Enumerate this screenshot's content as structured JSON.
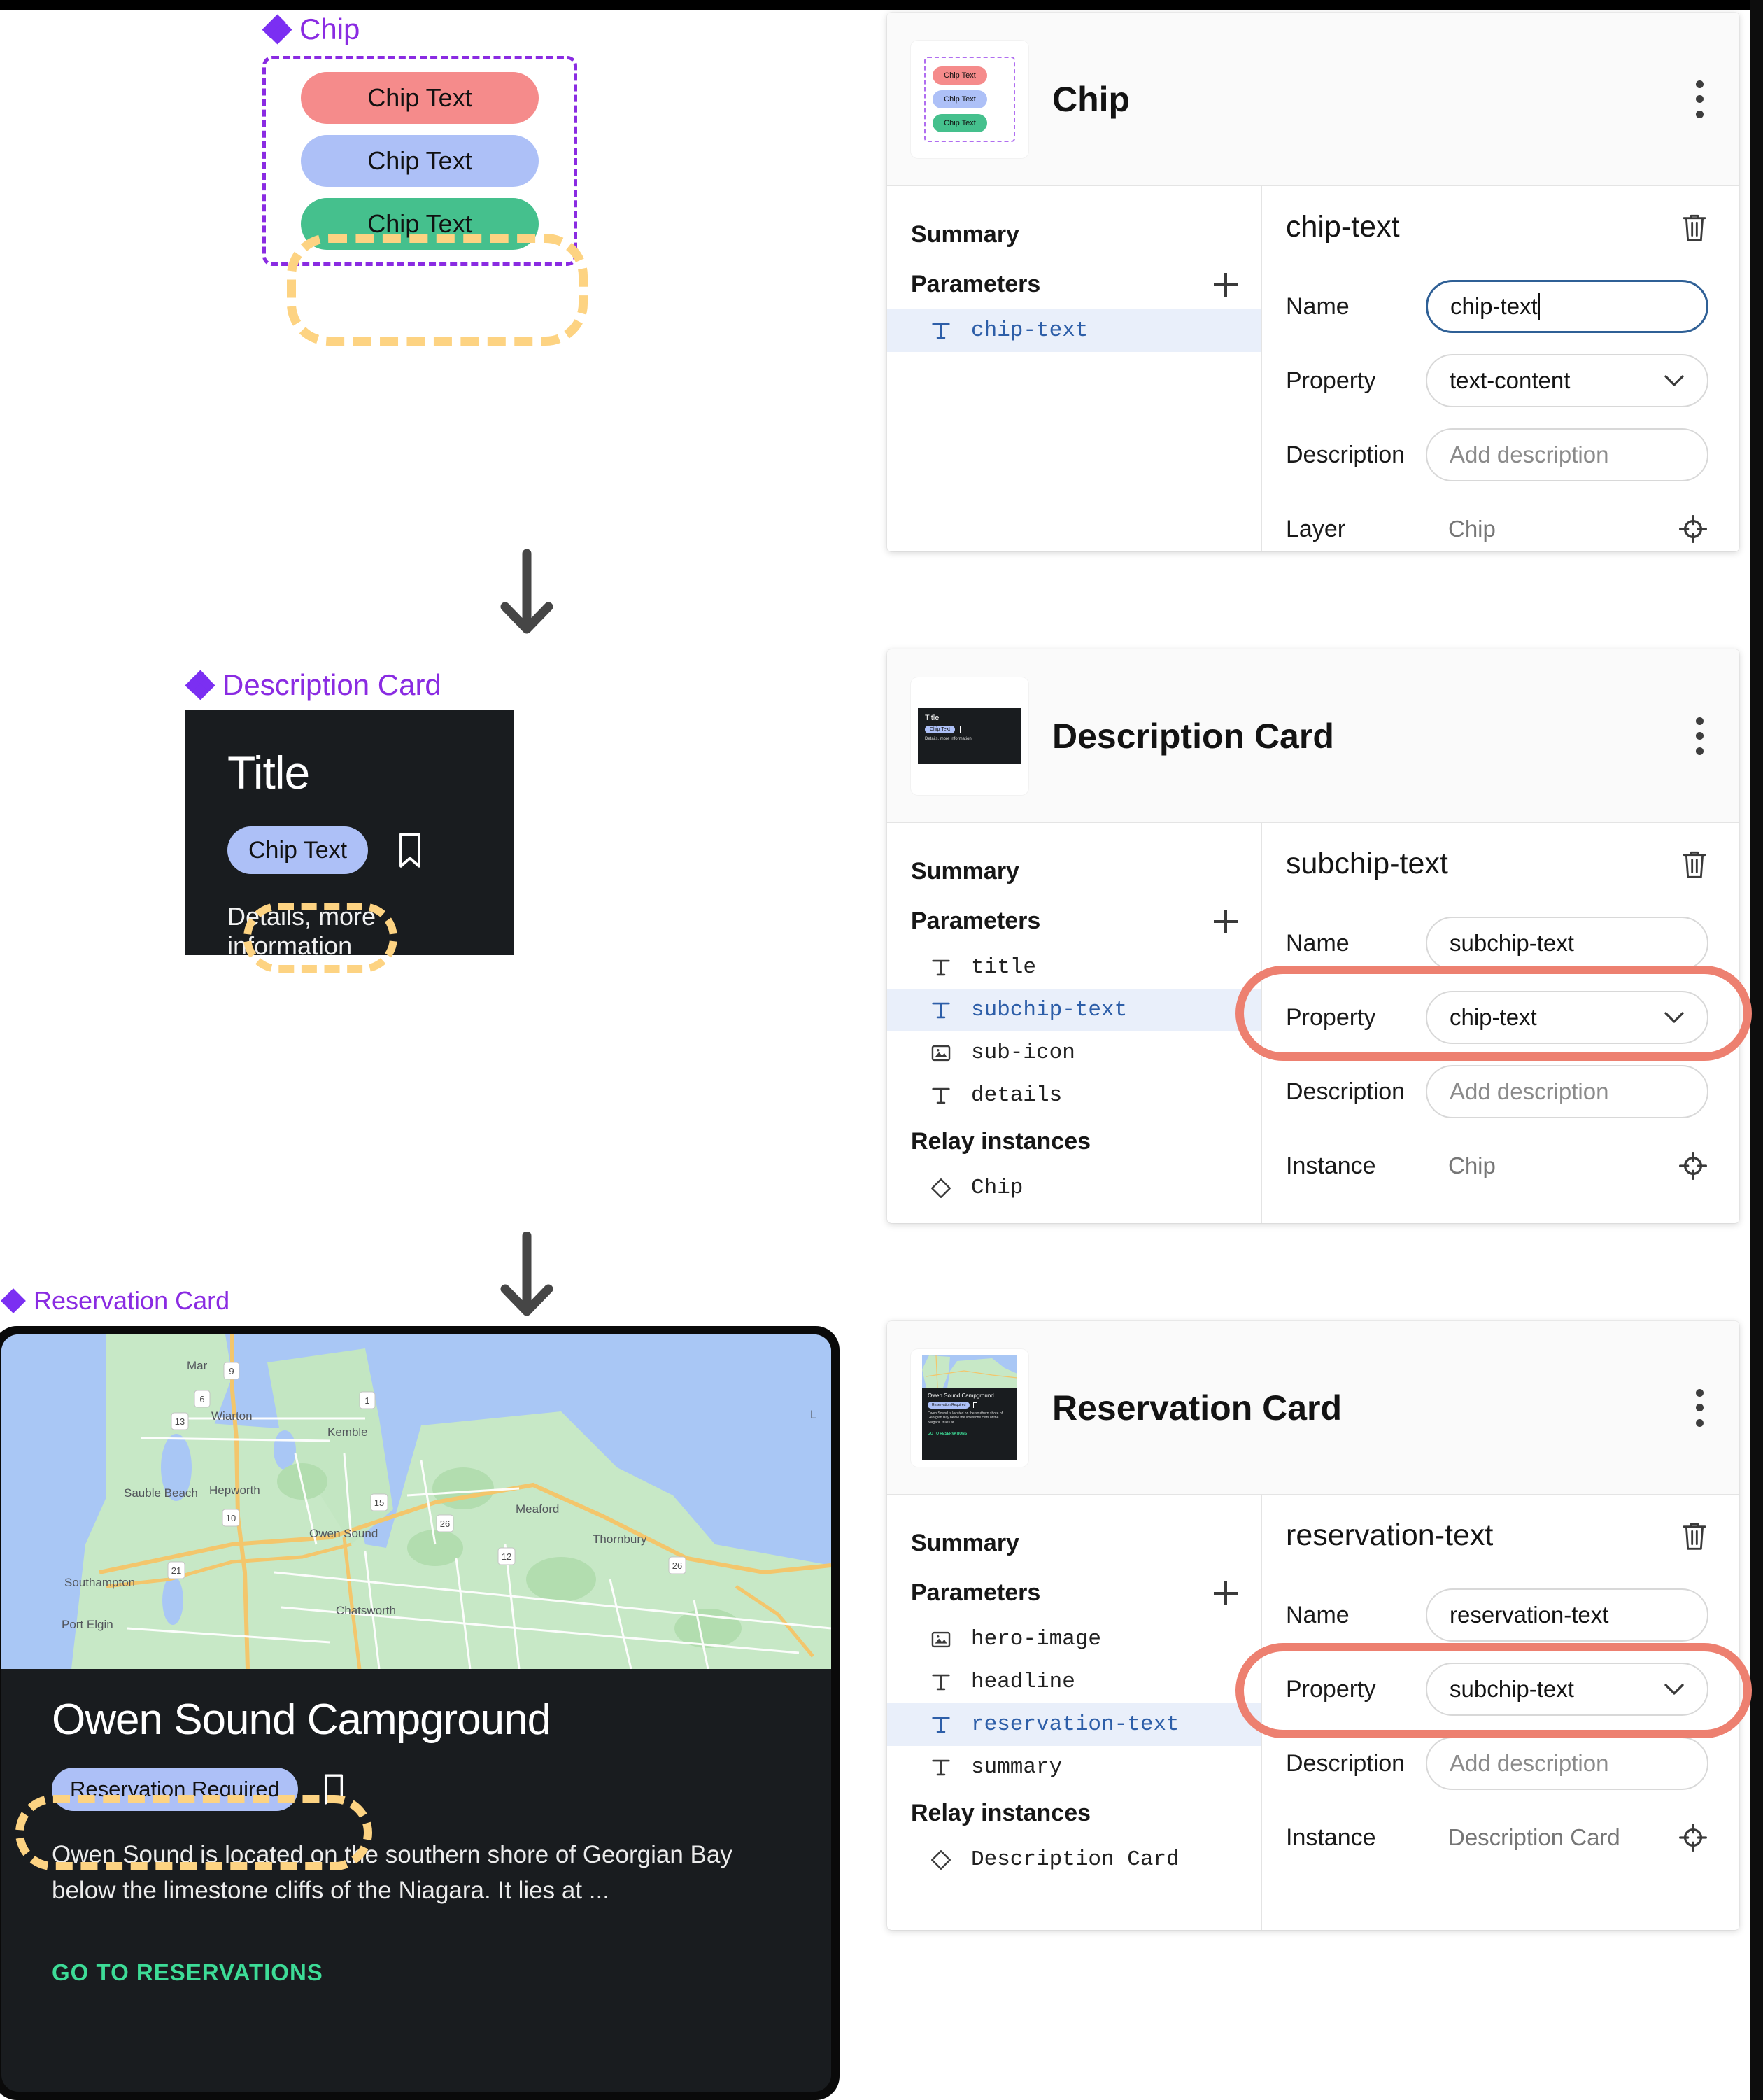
{
  "components": {
    "chip": {
      "label": "Chip",
      "chips": [
        {
          "text": "Chip Text",
          "color": "#f58b8b"
        },
        {
          "text": "Chip Text",
          "color": "#adc0f7"
        },
        {
          "text": "Chip Text",
          "color": "#45c08d"
        }
      ]
    },
    "description_card": {
      "label": "Description Card",
      "title": "Title",
      "chip_text": "Chip Text",
      "details": "Details, more information"
    },
    "reservation_card": {
      "label": "Reservation Card",
      "headline": "Owen Sound Campground",
      "chip_text": "Reservation Required",
      "summary": "Owen Sound is located on the southern shore of Georgian Bay below the limestone cliffs of the Niagara. It lies at ...",
      "action": "GO TO RESERVATIONS",
      "map_labels": [
        "Mar",
        "Wiarton",
        "Kemble",
        "Sauble Beach",
        "Hepworth",
        "Owen Sound",
        "Meaford",
        "Thornbury",
        "Southampton",
        "Chatsworth",
        "Port Elgin"
      ],
      "map_route_shields": [
        "9",
        "6",
        "1",
        "13",
        "15",
        "10",
        "26",
        "12",
        "26",
        "21"
      ]
    }
  },
  "panels": [
    {
      "title": "Chip",
      "summary_label": "Summary",
      "parameters_label": "Parameters",
      "parameters": [
        {
          "icon": "text-param-icon",
          "name": "chip-text",
          "selected": true
        }
      ],
      "relay_instances_label": null,
      "relay_instances": [],
      "detail": {
        "title": "chip-text",
        "name_label": "Name",
        "name_value": "chip-text",
        "name_focused": true,
        "property_label": "Property",
        "property_value": "text-content",
        "property_highlighted": false,
        "description_label": "Description",
        "description_placeholder": "Add description",
        "origin_label": "Layer",
        "origin_value": "Chip"
      }
    },
    {
      "title": "Description Card",
      "summary_label": "Summary",
      "parameters_label": "Parameters",
      "parameters": [
        {
          "icon": "text-param-icon",
          "name": "title",
          "selected": false
        },
        {
          "icon": "text-param-icon",
          "name": "subchip-text",
          "selected": true
        },
        {
          "icon": "image-param-icon",
          "name": "sub-icon",
          "selected": false
        },
        {
          "icon": "text-param-icon",
          "name": "details",
          "selected": false
        }
      ],
      "relay_instances_label": "Relay instances",
      "relay_instances": [
        {
          "icon": "diamond-instance-icon",
          "name": "Chip"
        }
      ],
      "detail": {
        "title": "subchip-text",
        "name_label": "Name",
        "name_value": "subchip-text",
        "name_focused": false,
        "property_label": "Property",
        "property_value": "chip-text",
        "property_highlighted": true,
        "description_label": "Description",
        "description_placeholder": "Add description",
        "origin_label": "Instance",
        "origin_value": "Chip"
      }
    },
    {
      "title": "Reservation Card",
      "summary_label": "Summary",
      "parameters_label": "Parameters",
      "parameters": [
        {
          "icon": "image-param-icon",
          "name": "hero-image",
          "selected": false
        },
        {
          "icon": "text-param-icon",
          "name": "headline",
          "selected": false
        },
        {
          "icon": "text-param-icon",
          "name": "reservation-text",
          "selected": true
        },
        {
          "icon": "text-param-icon",
          "name": "summary",
          "selected": false
        }
      ],
      "relay_instances_label": "Relay instances",
      "relay_instances": [
        {
          "icon": "diamond-instance-icon",
          "name": "Description Card"
        }
      ],
      "detail": {
        "title": "reservation-text",
        "name_label": "Name",
        "name_value": "reservation-text",
        "name_focused": false,
        "property_label": "Property",
        "property_value": "subchip-text",
        "property_highlighted": true,
        "description_label": "Description",
        "description_placeholder": "Add description",
        "origin_label": "Instance",
        "origin_value": "Description Card"
      }
    }
  ],
  "colors": {
    "component_label": "#8a2be2",
    "selection_ring": "#fdd382",
    "highlight_ellipse": "#ed8070",
    "chip_red": "#f58b8b",
    "chip_blue": "#adc0f7",
    "chip_green": "#45c08d",
    "card_dark": "#191c1f",
    "action_green": "#3ddc97",
    "focus_border": "#2f6096",
    "selected_row": "#e9effa"
  }
}
